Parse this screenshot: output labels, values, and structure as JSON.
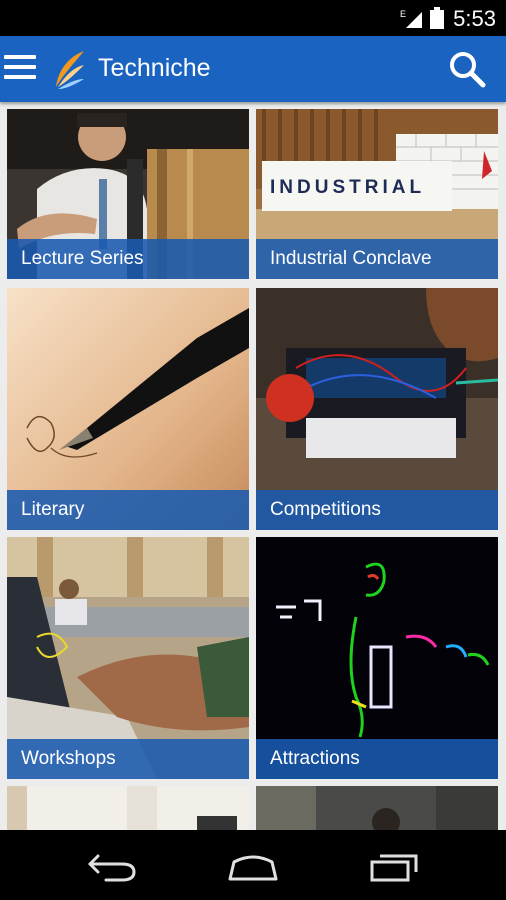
{
  "status_bar": {
    "time": "5:53",
    "network_label": "E",
    "icons": [
      "signal-icon",
      "battery-icon"
    ]
  },
  "app_bar": {
    "title": "Techniche",
    "icons": [
      "menu-icon",
      "logo-icon",
      "search-icon"
    ],
    "color": "#1a63c0"
  },
  "tiles": [
    {
      "label": "Lecture Series"
    },
    {
      "label": "Industrial Conclave",
      "image_text": "INDUSTRIAL"
    },
    {
      "label": "Literary"
    },
    {
      "label": "Competitions"
    },
    {
      "label": "Workshops"
    },
    {
      "label": "Attractions"
    }
  ],
  "caption_color": "#195aaf",
  "nav_bar": {
    "icons": [
      "back-icon",
      "home-icon",
      "recents-icon"
    ]
  }
}
